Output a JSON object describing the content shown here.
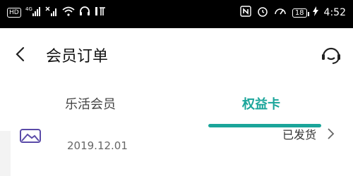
{
  "status_bar": {
    "left_icons": [
      "hd-icon",
      "signal-4g-icon",
      "signal-x-icon",
      "wifi-icon",
      "headset-icon",
      "audio-icon"
    ],
    "hd_label": "HD",
    "net_label": "4G",
    "battery": "18",
    "time": "4:52"
  },
  "header": {
    "title": "会员订单",
    "back_icon": "chevron-left-icon",
    "support_icon": "headset-icon"
  },
  "tabs": [
    {
      "label": "乐活会员",
      "active": false
    },
    {
      "label": "权益卡",
      "active": true
    }
  ],
  "order": {
    "date": "2019.12.01",
    "status": "已发货",
    "icon": "image-icon"
  },
  "colors": {
    "accent": "#1aa59a",
    "background": "#f3f3f3",
    "statusbar": "#000000"
  }
}
